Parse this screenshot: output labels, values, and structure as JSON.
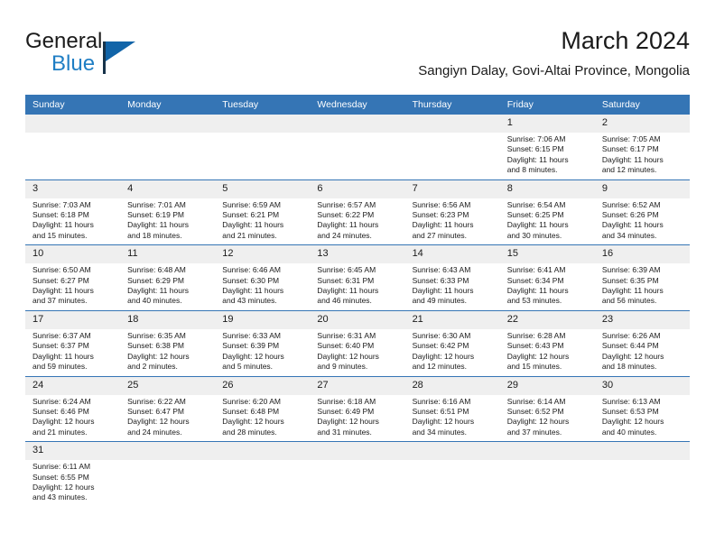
{
  "brand": {
    "name_top": "General",
    "name_bottom": "Blue",
    "color_dark": "#1b1b1b",
    "color_blue": "#1f7ec4",
    "triangle_color": "#1164a8"
  },
  "header": {
    "title": "March 2024",
    "subtitle": "Sangiyn Dalay, Govi-Altai Province, Mongolia"
  },
  "theme": {
    "header_bg": "#3575b5",
    "daynum_bg": "#efefef",
    "row_divider": "#3575b5",
    "text": "#1a1a1a"
  },
  "calendar": {
    "weekday_headers": [
      "Sunday",
      "Monday",
      "Tuesday",
      "Wednesday",
      "Thursday",
      "Friday",
      "Saturday"
    ],
    "weeks": [
      [
        {
          "day": "",
          "empty": true,
          "sunrise": "",
          "sunset": "",
          "daylight_line1": "",
          "daylight_line2": ""
        },
        {
          "day": "",
          "empty": true,
          "sunrise": "",
          "sunset": "",
          "daylight_line1": "",
          "daylight_line2": ""
        },
        {
          "day": "",
          "empty": true,
          "sunrise": "",
          "sunset": "",
          "daylight_line1": "",
          "daylight_line2": ""
        },
        {
          "day": "",
          "empty": true,
          "sunrise": "",
          "sunset": "",
          "daylight_line1": "",
          "daylight_line2": ""
        },
        {
          "day": "",
          "empty": true,
          "sunrise": "",
          "sunset": "",
          "daylight_line1": "",
          "daylight_line2": ""
        },
        {
          "day": "1",
          "empty": false,
          "sunrise": "Sunrise: 7:06 AM",
          "sunset": "Sunset: 6:15 PM",
          "daylight_line1": "Daylight: 11 hours",
          "daylight_line2": "and 8 minutes."
        },
        {
          "day": "2",
          "empty": false,
          "sunrise": "Sunrise: 7:05 AM",
          "sunset": "Sunset: 6:17 PM",
          "daylight_line1": "Daylight: 11 hours",
          "daylight_line2": "and 12 minutes."
        }
      ],
      [
        {
          "day": "3",
          "empty": false,
          "sunrise": "Sunrise: 7:03 AM",
          "sunset": "Sunset: 6:18 PM",
          "daylight_line1": "Daylight: 11 hours",
          "daylight_line2": "and 15 minutes."
        },
        {
          "day": "4",
          "empty": false,
          "sunrise": "Sunrise: 7:01 AM",
          "sunset": "Sunset: 6:19 PM",
          "daylight_line1": "Daylight: 11 hours",
          "daylight_line2": "and 18 minutes."
        },
        {
          "day": "5",
          "empty": false,
          "sunrise": "Sunrise: 6:59 AM",
          "sunset": "Sunset: 6:21 PM",
          "daylight_line1": "Daylight: 11 hours",
          "daylight_line2": "and 21 minutes."
        },
        {
          "day": "6",
          "empty": false,
          "sunrise": "Sunrise: 6:57 AM",
          "sunset": "Sunset: 6:22 PM",
          "daylight_line1": "Daylight: 11 hours",
          "daylight_line2": "and 24 minutes."
        },
        {
          "day": "7",
          "empty": false,
          "sunrise": "Sunrise: 6:56 AM",
          "sunset": "Sunset: 6:23 PM",
          "daylight_line1": "Daylight: 11 hours",
          "daylight_line2": "and 27 minutes."
        },
        {
          "day": "8",
          "empty": false,
          "sunrise": "Sunrise: 6:54 AM",
          "sunset": "Sunset: 6:25 PM",
          "daylight_line1": "Daylight: 11 hours",
          "daylight_line2": "and 30 minutes."
        },
        {
          "day": "9",
          "empty": false,
          "sunrise": "Sunrise: 6:52 AM",
          "sunset": "Sunset: 6:26 PM",
          "daylight_line1": "Daylight: 11 hours",
          "daylight_line2": "and 34 minutes."
        }
      ],
      [
        {
          "day": "10",
          "empty": false,
          "sunrise": "Sunrise: 6:50 AM",
          "sunset": "Sunset: 6:27 PM",
          "daylight_line1": "Daylight: 11 hours",
          "daylight_line2": "and 37 minutes."
        },
        {
          "day": "11",
          "empty": false,
          "sunrise": "Sunrise: 6:48 AM",
          "sunset": "Sunset: 6:29 PM",
          "daylight_line1": "Daylight: 11 hours",
          "daylight_line2": "and 40 minutes."
        },
        {
          "day": "12",
          "empty": false,
          "sunrise": "Sunrise: 6:46 AM",
          "sunset": "Sunset: 6:30 PM",
          "daylight_line1": "Daylight: 11 hours",
          "daylight_line2": "and 43 minutes."
        },
        {
          "day": "13",
          "empty": false,
          "sunrise": "Sunrise: 6:45 AM",
          "sunset": "Sunset: 6:31 PM",
          "daylight_line1": "Daylight: 11 hours",
          "daylight_line2": "and 46 minutes."
        },
        {
          "day": "14",
          "empty": false,
          "sunrise": "Sunrise: 6:43 AM",
          "sunset": "Sunset: 6:33 PM",
          "daylight_line1": "Daylight: 11 hours",
          "daylight_line2": "and 49 minutes."
        },
        {
          "day": "15",
          "empty": false,
          "sunrise": "Sunrise: 6:41 AM",
          "sunset": "Sunset: 6:34 PM",
          "daylight_line1": "Daylight: 11 hours",
          "daylight_line2": "and 53 minutes."
        },
        {
          "day": "16",
          "empty": false,
          "sunrise": "Sunrise: 6:39 AM",
          "sunset": "Sunset: 6:35 PM",
          "daylight_line1": "Daylight: 11 hours",
          "daylight_line2": "and 56 minutes."
        }
      ],
      [
        {
          "day": "17",
          "empty": false,
          "sunrise": "Sunrise: 6:37 AM",
          "sunset": "Sunset: 6:37 PM",
          "daylight_line1": "Daylight: 11 hours",
          "daylight_line2": "and 59 minutes."
        },
        {
          "day": "18",
          "empty": false,
          "sunrise": "Sunrise: 6:35 AM",
          "sunset": "Sunset: 6:38 PM",
          "daylight_line1": "Daylight: 12 hours",
          "daylight_line2": "and 2 minutes."
        },
        {
          "day": "19",
          "empty": false,
          "sunrise": "Sunrise: 6:33 AM",
          "sunset": "Sunset: 6:39 PM",
          "daylight_line1": "Daylight: 12 hours",
          "daylight_line2": "and 5 minutes."
        },
        {
          "day": "20",
          "empty": false,
          "sunrise": "Sunrise: 6:31 AM",
          "sunset": "Sunset: 6:40 PM",
          "daylight_line1": "Daylight: 12 hours",
          "daylight_line2": "and 9 minutes."
        },
        {
          "day": "21",
          "empty": false,
          "sunrise": "Sunrise: 6:30 AM",
          "sunset": "Sunset: 6:42 PM",
          "daylight_line1": "Daylight: 12 hours",
          "daylight_line2": "and 12 minutes."
        },
        {
          "day": "22",
          "empty": false,
          "sunrise": "Sunrise: 6:28 AM",
          "sunset": "Sunset: 6:43 PM",
          "daylight_line1": "Daylight: 12 hours",
          "daylight_line2": "and 15 minutes."
        },
        {
          "day": "23",
          "empty": false,
          "sunrise": "Sunrise: 6:26 AM",
          "sunset": "Sunset: 6:44 PM",
          "daylight_line1": "Daylight: 12 hours",
          "daylight_line2": "and 18 minutes."
        }
      ],
      [
        {
          "day": "24",
          "empty": false,
          "sunrise": "Sunrise: 6:24 AM",
          "sunset": "Sunset: 6:46 PM",
          "daylight_line1": "Daylight: 12 hours",
          "daylight_line2": "and 21 minutes."
        },
        {
          "day": "25",
          "empty": false,
          "sunrise": "Sunrise: 6:22 AM",
          "sunset": "Sunset: 6:47 PM",
          "daylight_line1": "Daylight: 12 hours",
          "daylight_line2": "and 24 minutes."
        },
        {
          "day": "26",
          "empty": false,
          "sunrise": "Sunrise: 6:20 AM",
          "sunset": "Sunset: 6:48 PM",
          "daylight_line1": "Daylight: 12 hours",
          "daylight_line2": "and 28 minutes."
        },
        {
          "day": "27",
          "empty": false,
          "sunrise": "Sunrise: 6:18 AM",
          "sunset": "Sunset: 6:49 PM",
          "daylight_line1": "Daylight: 12 hours",
          "daylight_line2": "and 31 minutes."
        },
        {
          "day": "28",
          "empty": false,
          "sunrise": "Sunrise: 6:16 AM",
          "sunset": "Sunset: 6:51 PM",
          "daylight_line1": "Daylight: 12 hours",
          "daylight_line2": "and 34 minutes."
        },
        {
          "day": "29",
          "empty": false,
          "sunrise": "Sunrise: 6:14 AM",
          "sunset": "Sunset: 6:52 PM",
          "daylight_line1": "Daylight: 12 hours",
          "daylight_line2": "and 37 minutes."
        },
        {
          "day": "30",
          "empty": false,
          "sunrise": "Sunrise: 6:13 AM",
          "sunset": "Sunset: 6:53 PM",
          "daylight_line1": "Daylight: 12 hours",
          "daylight_line2": "and 40 minutes."
        }
      ],
      [
        {
          "day": "31",
          "empty": false,
          "sunrise": "Sunrise: 6:11 AM",
          "sunset": "Sunset: 6:55 PM",
          "daylight_line1": "Daylight: 12 hours",
          "daylight_line2": "and 43 minutes."
        },
        {
          "day": "",
          "empty": true,
          "sunrise": "",
          "sunset": "",
          "daylight_line1": "",
          "daylight_line2": ""
        },
        {
          "day": "",
          "empty": true,
          "sunrise": "",
          "sunset": "",
          "daylight_line1": "",
          "daylight_line2": ""
        },
        {
          "day": "",
          "empty": true,
          "sunrise": "",
          "sunset": "",
          "daylight_line1": "",
          "daylight_line2": ""
        },
        {
          "day": "",
          "empty": true,
          "sunrise": "",
          "sunset": "",
          "daylight_line1": "",
          "daylight_line2": ""
        },
        {
          "day": "",
          "empty": true,
          "sunrise": "",
          "sunset": "",
          "daylight_line1": "",
          "daylight_line2": ""
        },
        {
          "day": "",
          "empty": true,
          "sunrise": "",
          "sunset": "",
          "daylight_line1": "",
          "daylight_line2": ""
        }
      ]
    ]
  }
}
